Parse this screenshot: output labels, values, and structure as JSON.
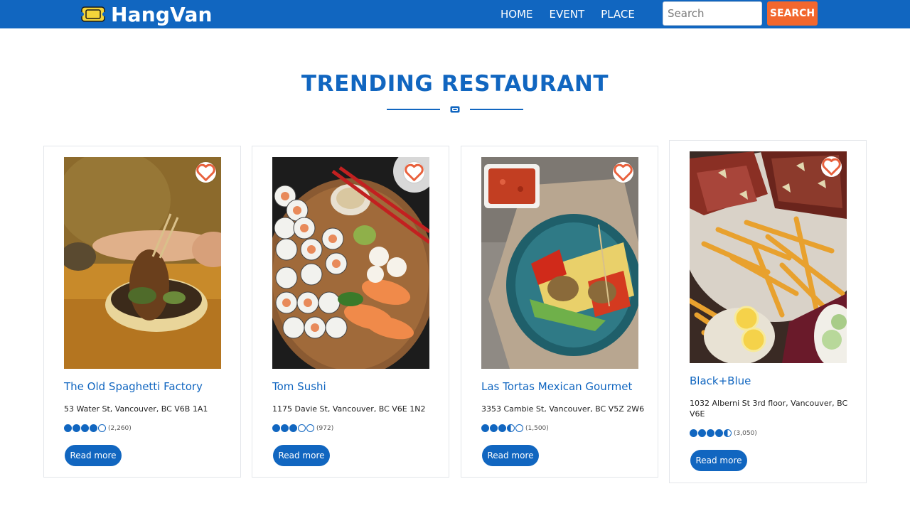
{
  "brand": {
    "name": "HangVan",
    "icon": "ticket-icon",
    "icon_color": "#f4d53a"
  },
  "nav": {
    "items": [
      "HOME",
      "EVENT",
      "PLACE"
    ]
  },
  "search": {
    "placeholder": "Search",
    "value": "",
    "button_label": "SEARCH"
  },
  "section": {
    "title": "TRENDING RESTAURANT",
    "divider_icon": "ticket-icon"
  },
  "colors": {
    "primary": "#1166c0",
    "accent": "#f2672e",
    "heart": "#e8603c"
  },
  "restaurants": [
    {
      "name": "The Old Spaghetti Factory",
      "address": "53 Water St, Vancouver, BC V6B 1A1",
      "rating": 4,
      "rating_count": "(2,260)",
      "button_label": "Read more",
      "favorite_icon": "heart-outline-icon",
      "photo": "spaghetti-dish"
    },
    {
      "name": "Tom Sushi",
      "address": "1175 Davie St, Vancouver, BC V6E 1N2",
      "rating": 3,
      "rating_count": "(972)",
      "button_label": "Read more",
      "favorite_icon": "heart-outline-icon",
      "photo": "sushi-platter"
    },
    {
      "name": "Las Tortas Mexican Gourmet",
      "address": "3353 Cambie St, Vancouver, BC V5Z 2W6",
      "rating": 3.5,
      "rating_count": "(1,500)",
      "button_label": "Read more",
      "favorite_icon": "heart-outline-icon",
      "photo": "mexican-wrap"
    },
    {
      "name": "Black+Blue",
      "address": "1032 Alberni St 3rd floor, Vancouver, BC V6E",
      "rating": 4.5,
      "rating_count": "(3,050)",
      "button_label": "Read more",
      "favorite_icon": "heart-outline-icon",
      "photo": "steak-and-fries"
    }
  ]
}
